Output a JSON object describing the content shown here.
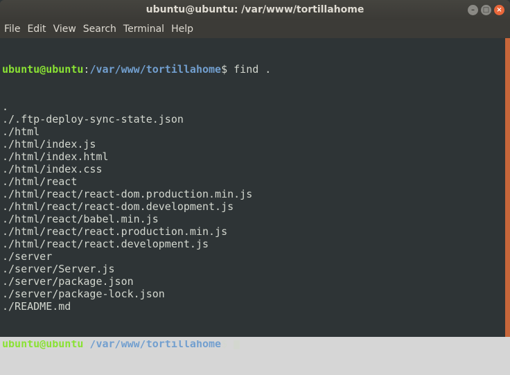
{
  "window": {
    "title": "ubuntu@ubuntu: /var/www/tortillahome",
    "buttons": {
      "minimize": "–",
      "maximize": "□",
      "close": "×"
    }
  },
  "menu": [
    "File",
    "Edit",
    "View",
    "Search",
    "Terminal",
    "Help"
  ],
  "terminal": {
    "user_host": "ubuntu@ubuntu",
    "colon": ":",
    "path": "/var/www/tortillahome",
    "prompt_symbol": "$ ",
    "command": "find .",
    "output": [
      ".",
      "./.ftp-deploy-sync-state.json",
      "./html",
      "./html/index.js",
      "./html/index.html",
      "./html/index.css",
      "./html/react",
      "./html/react/react-dom.production.min.js",
      "./html/react/react-dom.development.js",
      "./html/react/babel.min.js",
      "./html/react/react.production.min.js",
      "./html/react/react.development.js",
      "./server",
      "./server/Server.js",
      "./server/package.json",
      "./server/package-lock.json",
      "./README.md"
    ]
  }
}
